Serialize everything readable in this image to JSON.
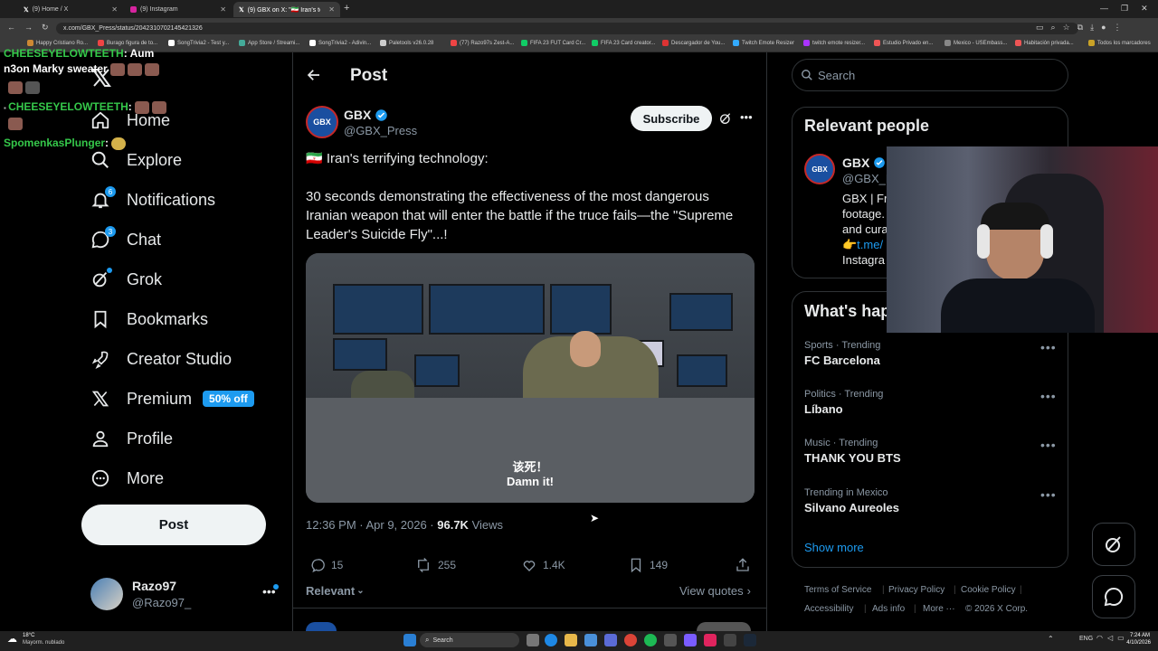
{
  "browser": {
    "tabs": [
      {
        "title": "(9) Home / X"
      },
      {
        "title": "(9) Instagram"
      },
      {
        "title": "(9) GBX on X: \"🇮🇷 Iran's terrif"
      }
    ],
    "url": "x.com/GBX_Press/status/2042310702145421326",
    "bookmarks": [
      "Happy Cristiano Ro...",
      "Burago figura de to...",
      "SongTrivia2 - Test y...",
      "App Store / Streami...",
      "SongTrivia2 - Adivin...",
      "Paletools v26.0.28",
      "(77) Razo97s Zest-A...",
      "FIFA 23 FUT Card Cr...",
      "FIFA 23 Card creator...",
      "Descargador de You...",
      "Twitch Emote Resizer",
      "twitch emote resizer...",
      "Estudio Privado en...",
      "Mexico - USEmbass...",
      "Habitación privada..."
    ],
    "all_bookmarks": "Todos los marcadores"
  },
  "chat_overlay": [
    {
      "user": "CHEESEYELOWTEETH",
      "msg": ": Aum"
    },
    {
      "user": "n3on Marky sweater",
      "msg": ""
    },
    {
      "user": "CHEESEYELOWTEETH",
      "msg": ":"
    },
    {
      "user": "SpomenkasPlunger",
      "msg": ":"
    }
  ],
  "nav": {
    "items": [
      {
        "label": "Home",
        "icon": "home-icon"
      },
      {
        "label": "Explore",
        "icon": "search-icon"
      },
      {
        "label": "Notifications",
        "icon": "bell-icon",
        "badge": "6"
      },
      {
        "label": "Chat",
        "icon": "chat-icon",
        "badge": "3"
      },
      {
        "label": "Grok",
        "icon": "grok-icon"
      },
      {
        "label": "Bookmarks",
        "icon": "bookmark-icon"
      },
      {
        "label": "Creator Studio",
        "icon": "rocket-icon"
      },
      {
        "label": "Premium",
        "icon": "x-logo-icon",
        "pill": "50% off"
      },
      {
        "label": "Profile",
        "icon": "person-icon"
      },
      {
        "label": "More",
        "icon": "more-circle-icon"
      }
    ],
    "post_button": "Post",
    "account": {
      "name": "Razo97",
      "handle": "@Razo97_"
    }
  },
  "post": {
    "header_title": "Post",
    "author": {
      "name": "GBX",
      "handle": "@GBX_Press",
      "avatar_text": "GBX"
    },
    "subscribe": "Subscribe",
    "line1": "🇮🇷 Iran's terrifying technology:",
    "line2": "30 seconds demonstrating the effectiveness of the most dangerous Iranian weapon that will enter the battle if the truce fails—the \"Supreme Leader's Suicide Fly\"...!",
    "subtitle_cn": "该死！",
    "subtitle_en": "Damn it!",
    "time": "12:36 PM · Apr 9, 2026 · ",
    "views_count": "96.7K",
    "views_label": " Views",
    "replies": "15",
    "reposts": "255",
    "likes": "1.4K",
    "bookmarks": "149",
    "sort": "Relevant",
    "view_quotes": "View quotes"
  },
  "right": {
    "search_placeholder": "Search",
    "relevant_title": "Relevant people",
    "person": {
      "name": "GBX",
      "handle": "@GBX_F",
      "bio1": "GBX | Fr",
      "bio2": "footage.",
      "bio3": "and cura",
      "bio4": "👉t.me/",
      "bio5": "Instagra"
    },
    "happening_title": "What's hap",
    "trends": [
      {
        "category": "Sports · Trending",
        "name": "FC Barcelona"
      },
      {
        "category": "Politics · Trending",
        "name": "Líbano"
      },
      {
        "category": "Music · Trending",
        "name": "THANK YOU BTS"
      },
      {
        "category": "Trending in Mexico",
        "name": "Silvano Aureoles"
      }
    ],
    "show_more": "Show more",
    "footer": [
      "Terms of Service",
      "Privacy Policy",
      "Cookie Policy",
      "Accessibility",
      "Ads info",
      "More ···",
      "© 2026 X Corp."
    ]
  },
  "taskbar": {
    "weather_temp": "18°C",
    "weather_desc": "Mayorm. nublado",
    "search": "Search",
    "lang": "ENG",
    "time": "7:24 AM",
    "date": "4/10/2026"
  },
  "colors": {
    "accent": "#1d9bf0",
    "bg": "#000000",
    "text": "#e7e9ea",
    "muted": "#8b98a5",
    "border": "#2f3336"
  }
}
